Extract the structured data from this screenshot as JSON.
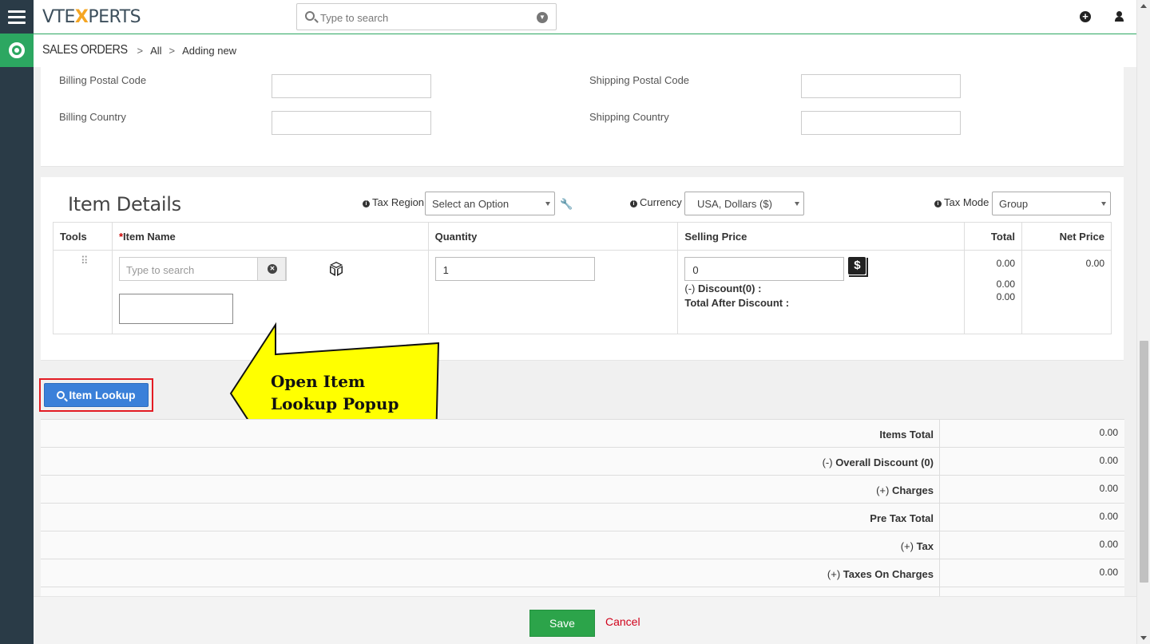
{
  "brand": {
    "logo_part1": "VTE",
    "logo_x": "X",
    "logo_part2": "PERTS"
  },
  "search": {
    "placeholder": "Type to search"
  },
  "breadcrumb": {
    "module": "SALES ORDERS",
    "sep": ">",
    "all": "All",
    "current": "Adding new"
  },
  "address": {
    "billing_postal_label": "Billing Postal Code",
    "billing_country_label": "Billing Country",
    "shipping_postal_label": "Shipping Postal Code",
    "shipping_country_label": "Shipping Country"
  },
  "item_details": {
    "title": "Item Details",
    "tax_region_label": "Tax Region",
    "tax_region_value": "Select an Option",
    "currency_label": "Currency",
    "currency_value": "USA, Dollars ($)",
    "tax_mode_label": "Tax Mode",
    "tax_mode_value": "Group",
    "columns": [
      "Tools",
      "Item Name",
      "Quantity",
      "Selling Price",
      "Total",
      "Net Price"
    ],
    "required_mark": "*",
    "row": {
      "item_placeholder": "Type to search",
      "quantity": "1",
      "selling_price": "0",
      "discount_sign": "(-)",
      "discount_label": "Discount(0) :",
      "total_after_discount_label": "Total After Discount :",
      "total": "0.00",
      "discount_amount": "0.00",
      "after_discount_amount": "0.00",
      "net_price": "0.00"
    }
  },
  "lookup": {
    "label": "Item Lookup"
  },
  "callout": {
    "line1": "Open Item",
    "line2": "Lookup Popup"
  },
  "totals": [
    {
      "sign": "",
      "label": "Items Total",
      "value": "0.00"
    },
    {
      "sign": "(-)",
      "label": "Overall Discount (0)",
      "value": "0.00"
    },
    {
      "sign": "(+)",
      "label": "Charges",
      "value": "0.00"
    },
    {
      "sign": "",
      "label": "Pre Tax Total",
      "value": "0.00"
    },
    {
      "sign": "(+)",
      "label": "Tax",
      "value": "0.00"
    },
    {
      "sign": "(+)",
      "label": "Taxes On Charges",
      "value": "0.00"
    }
  ],
  "footer": {
    "save": "Save",
    "cancel": "Cancel"
  },
  "colors": {
    "accent_green": "#2ca761",
    "lookup_blue": "#3a80d9",
    "callout_yellow": "#ffff00",
    "cancel_red": "#d0021b"
  },
  "icons": [
    "menu-icon",
    "module-icon",
    "search-icon",
    "dropdown-icon",
    "plus-icon",
    "user-icon",
    "info-icon",
    "wrench-icon",
    "drag-handle-icon",
    "clear-icon",
    "box-icon",
    "dollar-icon"
  ]
}
